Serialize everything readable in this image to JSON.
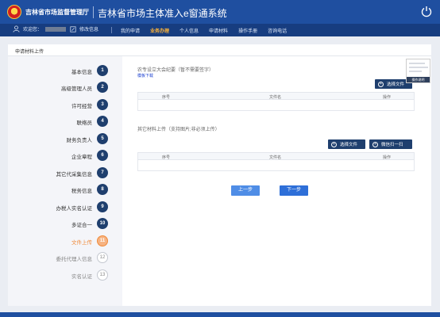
{
  "header": {
    "agency": "吉林省市场监督管理厅",
    "system_title": "吉林省市场主体准入e窗通系统"
  },
  "navbar": {
    "welcome": "欢迎您：",
    "edit_info": "修改信息",
    "links": [
      "我的申请",
      "业务办理",
      "个人信息",
      "申请材料",
      "操作手册",
      "咨询电话"
    ],
    "active_link": "业务办理"
  },
  "panel": {
    "title": "申请材料上传"
  },
  "sidebar": {
    "items": [
      {
        "label": "基本信息",
        "num": "1"
      },
      {
        "label": "高级管理人员",
        "num": "2"
      },
      {
        "label": "许可经营",
        "num": "3"
      },
      {
        "label": "联络员",
        "num": "4"
      },
      {
        "label": "财务负责人",
        "num": "5"
      },
      {
        "label": "企业章程",
        "num": "6"
      },
      {
        "label": "其它代采集信息",
        "num": "7"
      },
      {
        "label": "税务信息",
        "num": "8"
      },
      {
        "label": "办税人实名认证",
        "num": "9"
      },
      {
        "label": "多证合一",
        "num": "10"
      },
      {
        "label": "文件上传",
        "num": "11"
      },
      {
        "label": "委托代理人信息",
        "num": "12"
      },
      {
        "label": "实名认证",
        "num": "13"
      }
    ],
    "active_index": 10
  },
  "section1": {
    "title": "农专设立大会纪要（暂不需要签字）",
    "sample_link": "模板下载",
    "select_file": "选择文件",
    "columns": [
      "序号",
      "文件名",
      "操作"
    ]
  },
  "section2": {
    "title": "其它材料上传（支持图片;非必须上传）",
    "select_file": "选择文件",
    "wechat_scan": "微信扫一扫",
    "columns": [
      "序号",
      "文件名",
      "操作"
    ]
  },
  "thumbnail": {
    "caption": "操作说明"
  },
  "actions": {
    "prev": "上一步",
    "next": "下一步"
  },
  "icons": {
    "user": "user-icon",
    "edit": "edit-icon",
    "power": "power-icon",
    "plus": "plus-icon"
  },
  "colors": {
    "header_bg": "#1f4fa0",
    "nav_bg": "#173d80",
    "active_nav": "#ffb437",
    "step_active": "#f08a3a",
    "dark_button": "#1f3f6e",
    "primary": "#2e6fd8"
  }
}
